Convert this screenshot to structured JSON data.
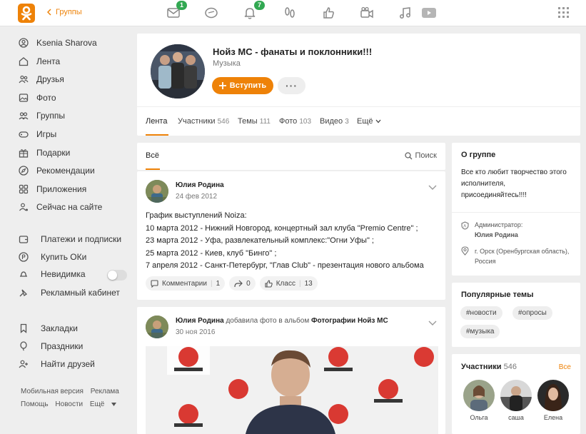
{
  "topbar": {
    "back_label": "Группы",
    "badges": {
      "messages": "1",
      "notifications": "7"
    }
  },
  "sidebar": {
    "items": [
      {
        "label": "Ksenia Sharova",
        "icon": "user-icon"
      },
      {
        "label": "Лента",
        "icon": "home-icon"
      },
      {
        "label": "Друзья",
        "icon": "friends-icon"
      },
      {
        "label": "Фото",
        "icon": "photo-icon"
      },
      {
        "label": "Группы",
        "icon": "groups-icon"
      },
      {
        "label": "Игры",
        "icon": "gamepad-icon"
      },
      {
        "label": "Подарки",
        "icon": "gift-icon"
      },
      {
        "label": "Рекомендации",
        "icon": "compass-icon"
      },
      {
        "label": "Приложения",
        "icon": "apps-icon"
      },
      {
        "label": "Сейчас на сайте",
        "icon": "online-icon"
      }
    ],
    "extra": [
      {
        "label": "Платежи и подписки",
        "icon": "wallet-icon"
      },
      {
        "label": "Купить ОКи",
        "icon": "coin-icon"
      },
      {
        "label": "Невидимка",
        "icon": "invisible-icon"
      },
      {
        "label": "Рекламный кабинет",
        "icon": "ads-icon"
      }
    ],
    "more": [
      {
        "label": "Закладки",
        "icon": "bookmark-icon"
      },
      {
        "label": "Праздники",
        "icon": "balloon-icon"
      },
      {
        "label": "Найти друзей",
        "icon": "add-friend-icon"
      }
    ],
    "footer_row1": [
      "Мобильная версия",
      "Реклама"
    ],
    "footer_row2": [
      "Помощь",
      "Новости",
      "Ещё"
    ]
  },
  "group": {
    "title": "Нойз МС - фанаты и поклонники!!!",
    "subtitle": "Музыка",
    "join_label": "Вступить",
    "more_label": "···",
    "tabs": [
      {
        "label": "Лента",
        "count": ""
      },
      {
        "label": "Участники",
        "count": "546"
      },
      {
        "label": "Темы",
        "count": "111"
      },
      {
        "label": "Фото",
        "count": "103"
      },
      {
        "label": "Видео",
        "count": "3"
      },
      {
        "label": "Ещё",
        "count": ""
      }
    ]
  },
  "feed": {
    "tab_label": "Всё",
    "search_label": "Поиск"
  },
  "post1": {
    "author": "Юлия Родина",
    "date": "24 фев 2012",
    "lines": [
      "График выступлений Noiza:",
      "10 марта 2012 - Нижний Новгород, концертный зал клуба \"Premio Centre\" ;",
      "23 марта 2012 - Уфа, развлекательный комплекс:\"Огни Уфы\" ;",
      "25 марта 2012 - Киев, клуб \"Бинго\" ;",
      "7 апреля 2012 - Санкт-Петербург, \"Глав Club\" - презентация нового альбома"
    ],
    "actions": {
      "comments_label": "Комментарии",
      "comments_count": "1",
      "share_count": "0",
      "like_label": "Класс",
      "like_count": "13"
    }
  },
  "post2": {
    "author": "Юлия Родина",
    "action_text": "добавила фото в альбом",
    "album": "Фотографии Нойз МС",
    "date": "30 ноя 2016"
  },
  "about": {
    "title": "О группе",
    "text": "Все кто любит творчество этого исполнителя, присоединяйтесь!!!!",
    "admin_label": "Администратор:",
    "admin_name": "Юлия Родина",
    "location": "г. Орск (Оренбургская область), Россия"
  },
  "topics": {
    "title": "Популярные темы",
    "tags": [
      "#новости",
      "#опросы",
      "#музыка"
    ]
  },
  "members": {
    "title": "Участники",
    "count": "546",
    "all_label": "Все",
    "list": [
      {
        "name": "Ольга"
      },
      {
        "name": "саша"
      },
      {
        "name": "Елена"
      }
    ]
  },
  "colors": {
    "accent": "#ee8208",
    "badge": "#32a852",
    "background": "#eeeeee"
  }
}
